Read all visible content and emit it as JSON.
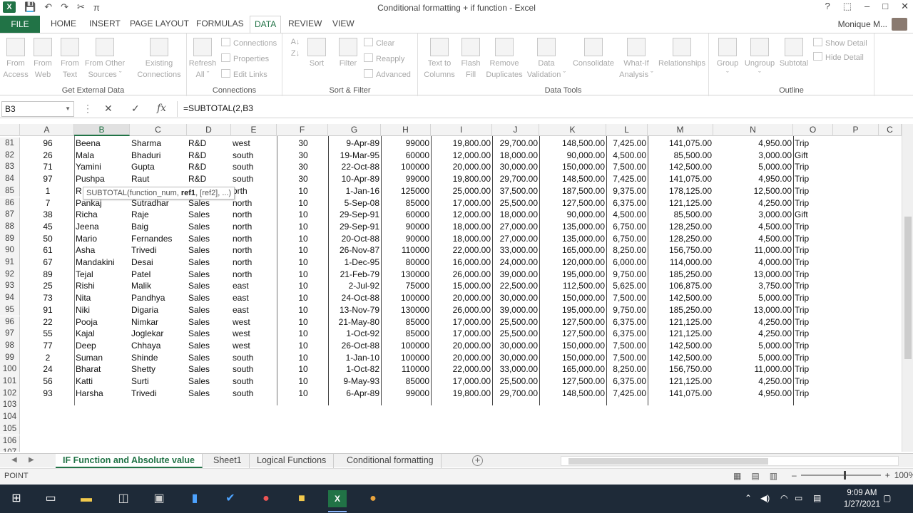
{
  "window": {
    "title": "Conditional formatting + if function - Excel",
    "controls": [
      "?",
      "⬚",
      "–",
      "□",
      "✕"
    ]
  },
  "qat": {
    "excel_logo": "X",
    "save": "💾",
    "undo": "↶",
    "redo": "↷",
    "format_painter": "✂",
    "pi": "π"
  },
  "tabs": [
    "FILE",
    "HOME",
    "INSERT",
    "PAGE LAYOUT",
    "FORMULAS",
    "DATA",
    "REVIEW",
    "VIEW"
  ],
  "active_tab": "DATA",
  "user": "Monique M...",
  "ribbon": {
    "get_external": {
      "label": "Get External Data",
      "buttons": [
        "From\nAccess",
        "From\nWeb",
        "From\nText",
        "From Other\nSources ˇ",
        "Existing\nConnections"
      ]
    },
    "connections": {
      "label": "Connections",
      "refresh": "Refresh\nAll ˇ",
      "items": [
        "Connections",
        "Properties",
        "Edit Links"
      ]
    },
    "sort_filter": {
      "label": "Sort & Filter",
      "sort": "Sort",
      "filter": "Filter",
      "items": [
        "Clear",
        "Reapply",
        "Advanced"
      ]
    },
    "data_tools": {
      "label": "Data Tools",
      "buttons": [
        "Text to\nColumns",
        "Flash\nFill",
        "Remove\nDuplicates",
        "Data\nValidation ˇ",
        "Consolidate",
        "What-If\nAnalysis ˇ",
        "Relationships"
      ]
    },
    "outline": {
      "label": "Outline",
      "buttons": [
        "Group\nˇ",
        "Ungroup\nˇ",
        "Subtotal"
      ],
      "items": [
        "Show Detail",
        "Hide Detail"
      ]
    }
  },
  "formula_bar": {
    "name_box": "B3",
    "cancel": "✕",
    "enter": "✓",
    "fx": "fx",
    "formula": "=SUBTOTAL(2,B3"
  },
  "columns": [
    "A",
    "B",
    "C",
    "D",
    "E",
    "F",
    "G",
    "H",
    "I",
    "J",
    "K",
    "L",
    "M",
    "N",
    "O",
    "P",
    "C"
  ],
  "selected_column": "B",
  "rows": [
    {
      "n": "81",
      "A": "96",
      "B": "Beena",
      "C": "Sharma",
      "D": "R&D",
      "E": "west",
      "F": "30",
      "G": "9-Apr-89",
      "H": "99000",
      "I": "19,800.00",
      "J": "29,700.00",
      "K": "148,500.00",
      "L": "7,425.00",
      "M": "141,075.00",
      "N": "4,950.00",
      "O": "Trip"
    },
    {
      "n": "82",
      "A": "26",
      "B": "Mala",
      "C": "Bhaduri",
      "D": "R&D",
      "E": "south",
      "F": "30",
      "G": "19-Mar-95",
      "H": "60000",
      "I": "12,000.00",
      "J": "18,000.00",
      "K": "90,000.00",
      "L": "4,500.00",
      "M": "85,500.00",
      "N": "3,000.00",
      "O": "Gift"
    },
    {
      "n": "83",
      "A": "71",
      "B": "Yamini",
      "C": "Gupta",
      "D": "R&D",
      "E": "south",
      "F": "30",
      "G": "22-Oct-88",
      "H": "100000",
      "I": "20,000.00",
      "J": "30,000.00",
      "K": "150,000.00",
      "L": "7,500.00",
      "M": "142,500.00",
      "N": "5,000.00",
      "O": "Trip"
    },
    {
      "n": "84",
      "A": "97",
      "B": "Pushpa",
      "C": "Raut",
      "D": "R&D",
      "E": "south",
      "F": "30",
      "G": "10-Apr-89",
      "H": "99000",
      "I": "19,800.00",
      "J": "29,700.00",
      "K": "148,500.00",
      "L": "7,425.00",
      "M": "141,075.00",
      "N": "4,950.00",
      "O": "Trip"
    },
    {
      "n": "85",
      "A": "1",
      "B": "R",
      "C": "",
      "D": "",
      "E": "orth",
      "F": "10",
      "G": "1-Jan-16",
      "H": "125000",
      "I": "25,000.00",
      "J": "37,500.00",
      "K": "187,500.00",
      "L": "9,375.00",
      "M": "178,125.00",
      "N": "12,500.00",
      "O": "Trip"
    },
    {
      "n": "86",
      "A": "7",
      "B": "Pankaj",
      "C": "Sutradhar",
      "D": "Sales",
      "E": "north",
      "F": "10",
      "G": "5-Sep-08",
      "H": "85000",
      "I": "17,000.00",
      "J": "25,500.00",
      "K": "127,500.00",
      "L": "6,375.00",
      "M": "121,125.00",
      "N": "4,250.00",
      "O": "Trip"
    },
    {
      "n": "87",
      "A": "38",
      "B": "Richa",
      "C": "Raje",
      "D": "Sales",
      "E": "north",
      "F": "10",
      "G": "29-Sep-91",
      "H": "60000",
      "I": "12,000.00",
      "J": "18,000.00",
      "K": "90,000.00",
      "L": "4,500.00",
      "M": "85,500.00",
      "N": "3,000.00",
      "O": "Gift"
    },
    {
      "n": "88",
      "A": "45",
      "B": "Jeena",
      "C": "Baig",
      "D": "Sales",
      "E": "north",
      "F": "10",
      "G": "29-Sep-91",
      "H": "90000",
      "I": "18,000.00",
      "J": "27,000.00",
      "K": "135,000.00",
      "L": "6,750.00",
      "M": "128,250.00",
      "N": "4,500.00",
      "O": "Trip"
    },
    {
      "n": "89",
      "A": "50",
      "B": "Mario",
      "C": "Fernandes",
      "D": "Sales",
      "E": "north",
      "F": "10",
      "G": "20-Oct-88",
      "H": "90000",
      "I": "18,000.00",
      "J": "27,000.00",
      "K": "135,000.00",
      "L": "6,750.00",
      "M": "128,250.00",
      "N": "4,500.00",
      "O": "Trip"
    },
    {
      "n": "90",
      "A": "61",
      "B": "Asha",
      "C": "Trivedi",
      "D": "Sales",
      "E": "north",
      "F": "10",
      "G": "26-Nov-87",
      "H": "110000",
      "I": "22,000.00",
      "J": "33,000.00",
      "K": "165,000.00",
      "L": "8,250.00",
      "M": "156,750.00",
      "N": "11,000.00",
      "O": "Trip"
    },
    {
      "n": "91",
      "A": "67",
      "B": "Mandakini",
      "C": "Desai",
      "D": "Sales",
      "E": "north",
      "F": "10",
      "G": "1-Dec-95",
      "H": "80000",
      "I": "16,000.00",
      "J": "24,000.00",
      "K": "120,000.00",
      "L": "6,000.00",
      "M": "114,000.00",
      "N": "4,000.00",
      "O": "Trip"
    },
    {
      "n": "92",
      "A": "89",
      "B": "Tejal",
      "C": "Patel",
      "D": "Sales",
      "E": "north",
      "F": "10",
      "G": "21-Feb-79",
      "H": "130000",
      "I": "26,000.00",
      "J": "39,000.00",
      "K": "195,000.00",
      "L": "9,750.00",
      "M": "185,250.00",
      "N": "13,000.00",
      "O": "Trip"
    },
    {
      "n": "93",
      "A": "25",
      "B": "Rishi",
      "C": "Malik",
      "D": "Sales",
      "E": "east",
      "F": "10",
      "G": "2-Jul-92",
      "H": "75000",
      "I": "15,000.00",
      "J": "22,500.00",
      "K": "112,500.00",
      "L": "5,625.00",
      "M": "106,875.00",
      "N": "3,750.00",
      "O": "Trip"
    },
    {
      "n": "94",
      "A": "73",
      "B": "Nita",
      "C": "Pandhya",
      "D": "Sales",
      "E": "east",
      "F": "10",
      "G": "24-Oct-88",
      "H": "100000",
      "I": "20,000.00",
      "J": "30,000.00",
      "K": "150,000.00",
      "L": "7,500.00",
      "M": "142,500.00",
      "N": "5,000.00",
      "O": "Trip"
    },
    {
      "n": "95",
      "A": "91",
      "B": "Niki",
      "C": "Digaria",
      "D": "Sales",
      "E": "east",
      "F": "10",
      "G": "13-Nov-79",
      "H": "130000",
      "I": "26,000.00",
      "J": "39,000.00",
      "K": "195,000.00",
      "L": "9,750.00",
      "M": "185,250.00",
      "N": "13,000.00",
      "O": "Trip"
    },
    {
      "n": "96",
      "A": "22",
      "B": "Pooja",
      "C": "Nimkar",
      "D": "Sales",
      "E": "west",
      "F": "10",
      "G": "21-May-80",
      "H": "85000",
      "I": "17,000.00",
      "J": "25,500.00",
      "K": "127,500.00",
      "L": "6,375.00",
      "M": "121,125.00",
      "N": "4,250.00",
      "O": "Trip"
    },
    {
      "n": "97",
      "A": "55",
      "B": "Kajal",
      "C": "Joglekar",
      "D": "Sales",
      "E": "west",
      "F": "10",
      "G": "1-Oct-92",
      "H": "85000",
      "I": "17,000.00",
      "J": "25,500.00",
      "K": "127,500.00",
      "L": "6,375.00",
      "M": "121,125.00",
      "N": "4,250.00",
      "O": "Trip"
    },
    {
      "n": "98",
      "A": "77",
      "B": "Deep",
      "C": "Chhaya",
      "D": "Sales",
      "E": "west",
      "F": "10",
      "G": "26-Oct-88",
      "H": "100000",
      "I": "20,000.00",
      "J": "30,000.00",
      "K": "150,000.00",
      "L": "7,500.00",
      "M": "142,500.00",
      "N": "5,000.00",
      "O": "Trip"
    },
    {
      "n": "99",
      "A": "2",
      "B": "Suman",
      "C": "Shinde",
      "D": "Sales",
      "E": "south",
      "F": "10",
      "G": "1-Jan-10",
      "H": "100000",
      "I": "20,000.00",
      "J": "30,000.00",
      "K": "150,000.00",
      "L": "7,500.00",
      "M": "142,500.00",
      "N": "5,000.00",
      "O": "Trip"
    },
    {
      "n": "100",
      "A": "24",
      "B": "Bharat",
      "C": "Shetty",
      "D": "Sales",
      "E": "south",
      "F": "10",
      "G": "1-Oct-82",
      "H": "110000",
      "I": "22,000.00",
      "J": "33,000.00",
      "K": "165,000.00",
      "L": "8,250.00",
      "M": "156,750.00",
      "N": "11,000.00",
      "O": "Trip"
    },
    {
      "n": "101",
      "A": "56",
      "B": "Katti",
      "C": "Surti",
      "D": "Sales",
      "E": "south",
      "F": "10",
      "G": "9-May-93",
      "H": "85000",
      "I": "17,000.00",
      "J": "25,500.00",
      "K": "127,500.00",
      "L": "6,375.00",
      "M": "121,125.00",
      "N": "4,250.00",
      "O": "Trip"
    },
    {
      "n": "102",
      "A": "93",
      "B": "Harsha",
      "C": "Trivedi",
      "D": "Sales",
      "E": "south",
      "F": "10",
      "G": "6-Apr-89",
      "H": "99000",
      "I": "19,800.00",
      "J": "29,700.00",
      "K": "148,500.00",
      "L": "7,425.00",
      "M": "141,075.00",
      "N": "4,950.00",
      "O": "Trip"
    },
    {
      "n": "103"
    },
    {
      "n": "104"
    },
    {
      "n": "105"
    },
    {
      "n": "106"
    },
    {
      "n": "107"
    }
  ],
  "tooltip": {
    "fn": "SUBTOTAL(function_num, ",
    "bold": "ref1",
    "rest": ", [ref2], ...)"
  },
  "sheet_tabs": [
    "IF Function and Absolute value",
    "Sheet1",
    "Logical Functions",
    "Conditional formatting"
  ],
  "active_sheet": "IF Function and Absolute value",
  "add_sheet": "+",
  "status": {
    "mode": "POINT",
    "zoom": "100%",
    "minus": "–",
    "plus": "+"
  },
  "taskbar": {
    "time": "9:09 AM",
    "date": "1/27/2021"
  },
  "colors": {
    "excel_green": "#217346",
    "taskbar": "#1e2a38"
  }
}
